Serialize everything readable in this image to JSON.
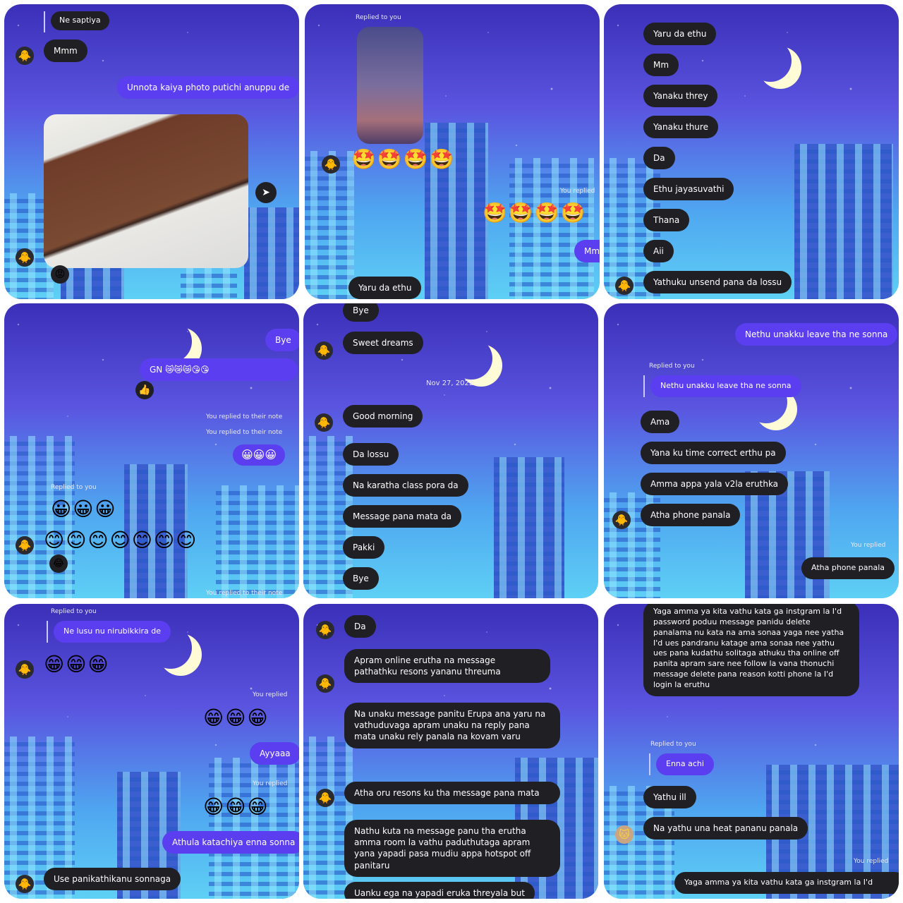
{
  "p1": {
    "quote": "Ne saptiya",
    "msg_mmm": "Mmm",
    "msg_sent": "Unnota kaiya photo putichi anuppu de",
    "reaction": "😡"
  },
  "p2": {
    "replied": "Replied to you",
    "emoji_row1": "🤩🤩🤩🤩",
    "you_replied": "You replied",
    "emoji_row2": "🤩🤩🤩🤩",
    "msg_mm": "Mm",
    "msg_yaru": "Yaru da ethu"
  },
  "p3": {
    "msgs": [
      "Yaru da ethu",
      "Mm",
      "Yanaku threy",
      "Yanaku thure",
      "Da",
      "Ethu jayasuvathi",
      "Thana",
      "Aii",
      "Yathuku unsend pana da lossu"
    ]
  },
  "p4": {
    "bye": "Bye",
    "gn": "GN 😿😿😿😘😘",
    "react": "👍",
    "note1": "You replied to their note",
    "note2": "You replied to their note",
    "smiles_sent": "😀😀😀",
    "replied": "Replied to you",
    "emoji_row1": "😀😀😀",
    "emoji_row2": "😊😊😊😊😊😊😊",
    "react2": "😂",
    "note3": "You replied to their note"
  },
  "p5": {
    "bye_top": "Bye",
    "sweet": "Sweet dreams",
    "date": "Nov 27, 2022",
    "msgs": [
      "Good morning",
      "Da lossu",
      "Na karatha class pora da",
      "Message pana mata da",
      "Pakki",
      "Bye"
    ]
  },
  "p6": {
    "sent": "Nethu unakku leave tha ne sonna",
    "replied": "Replied to you",
    "quote": "Nethu unakku leave tha ne sonna",
    "msgs": [
      "Ama",
      "Yana ku time correct erthu pa",
      "Amma appa yala v2la eruthka",
      "Atha phone panala"
    ],
    "you_replied": "You replied",
    "sent2": "Atha phone panala"
  },
  "p7": {
    "replied": "Replied to you",
    "quote": "Ne lusu nu nirubikkira de",
    "emoji_row1": "😁😁😁",
    "you_replied1": "You replied",
    "emoji_row2": "😁😁😁",
    "ayyaa": "Ayyaaa",
    "you_replied2": "You replied",
    "emoji_row3": "😁😁😁",
    "athula": "Athula katachiya enna sonna",
    "use": "Use panikathikanu sonnaga"
  },
  "p8": {
    "msgs": [
      "Da",
      "Apram online erutha na message pathathku resons yananu threuma",
      "Na unaku message panitu Erupa ana yaru na vathuduvaga apram unaku na reply pana mata unaku rely panala na kovam varu",
      "Atha oru resons ku tha message pana mata",
      "Nathu kuta na message panu tha erutha amma room la vathu paduthutaga apram yana yapadi pasa mudiu appa hotspot off panitaru",
      "Uanku ega na yapadi eruka threyala but"
    ]
  },
  "p9": {
    "long": "Yaga amma ya kita vathu kata ga instgram la I'd password poduu message panidu delete panalama nu kata na ama sonaa yaga nee yatha I'd ues pandranu katage ama sonaa nee yathu ues pana kudathu solitaga athuku tha online off panita apram sare nee follow la vana thonuchi message delete pana reason kotti phone la I'd login la eruthu",
    "replied": "Replied to you",
    "quote": "Enna achi",
    "msgs": [
      "Yathu ill",
      "Na yathu una heat pananu panala"
    ],
    "you_replied": "You replied",
    "sent": "Yaga amma ya kita vathu kata ga instgram la I'd"
  }
}
